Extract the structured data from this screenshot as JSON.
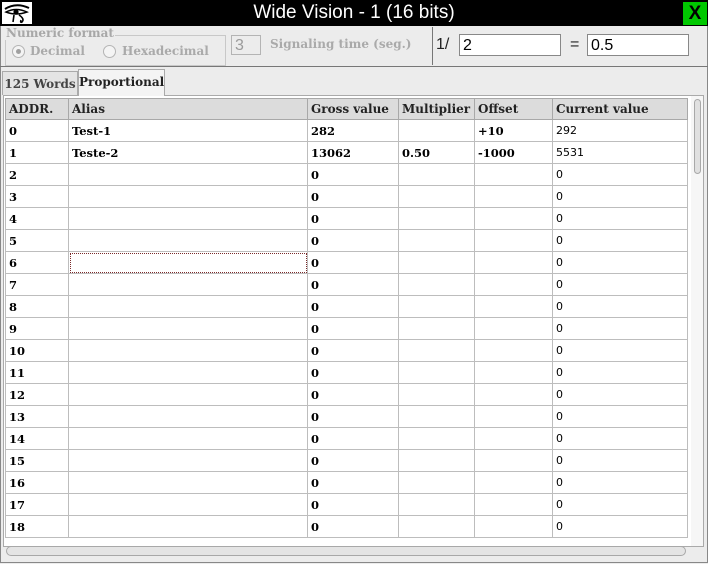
{
  "window": {
    "title": "Wide Vision - 1 (16 bits)",
    "close_label": "X"
  },
  "numeric_format": {
    "title": "Numeric format",
    "options": [
      {
        "label": "Decimal",
        "selected": true
      },
      {
        "label": "Hexadecimal",
        "selected": false
      }
    ]
  },
  "signaling": {
    "value": "3",
    "label": "Signaling time (seg.)"
  },
  "ratio": {
    "prefix": "1/",
    "denominator": "2",
    "equals": "=",
    "result": "0.5"
  },
  "tabs": [
    {
      "label": "125 Words",
      "active": false
    },
    {
      "label": "Proportional",
      "active": true
    }
  ],
  "table": {
    "headers": {
      "addr": "ADDR.",
      "alias": "Alias",
      "gross": "Gross value",
      "mult": "Multiplier",
      "offset": "Offset",
      "current": "Current value"
    },
    "rows": [
      {
        "addr": "0",
        "alias": "Test-1",
        "gross": "282",
        "mult": "",
        "offset": "+10",
        "current": "292"
      },
      {
        "addr": "1",
        "alias": "Teste-2",
        "gross": "13062",
        "mult": "0.50",
        "offset": "-1000",
        "current": "5531"
      },
      {
        "addr": "2",
        "alias": "",
        "gross": "0",
        "mult": "",
        "offset": "",
        "current": "0"
      },
      {
        "addr": "3",
        "alias": "",
        "gross": "0",
        "mult": "",
        "offset": "",
        "current": "0"
      },
      {
        "addr": "4",
        "alias": "",
        "gross": "0",
        "mult": "",
        "offset": "",
        "current": "0"
      },
      {
        "addr": "5",
        "alias": "",
        "gross": "0",
        "mult": "",
        "offset": "",
        "current": "0"
      },
      {
        "addr": "6",
        "alias": "",
        "gross": "0",
        "mult": "",
        "offset": "",
        "current": "0"
      },
      {
        "addr": "7",
        "alias": "",
        "gross": "0",
        "mult": "",
        "offset": "",
        "current": "0"
      },
      {
        "addr": "8",
        "alias": "",
        "gross": "0",
        "mult": "",
        "offset": "",
        "current": "0"
      },
      {
        "addr": "9",
        "alias": "",
        "gross": "0",
        "mult": "",
        "offset": "",
        "current": "0"
      },
      {
        "addr": "10",
        "alias": "",
        "gross": "0",
        "mult": "",
        "offset": "",
        "current": "0"
      },
      {
        "addr": "11",
        "alias": "",
        "gross": "0",
        "mult": "",
        "offset": "",
        "current": "0"
      },
      {
        "addr": "12",
        "alias": "",
        "gross": "0",
        "mult": "",
        "offset": "",
        "current": "0"
      },
      {
        "addr": "13",
        "alias": "",
        "gross": "0",
        "mult": "",
        "offset": "",
        "current": "0"
      },
      {
        "addr": "14",
        "alias": "",
        "gross": "0",
        "mult": "",
        "offset": "",
        "current": "0"
      },
      {
        "addr": "15",
        "alias": "",
        "gross": "0",
        "mult": "",
        "offset": "",
        "current": "0"
      },
      {
        "addr": "16",
        "alias": "",
        "gross": "0",
        "mult": "",
        "offset": "",
        "current": "0"
      },
      {
        "addr": "17",
        "alias": "",
        "gross": "0",
        "mult": "",
        "offset": "",
        "current": "0"
      },
      {
        "addr": "18",
        "alias": "",
        "gross": "0",
        "mult": "",
        "offset": "",
        "current": "0"
      }
    ]
  }
}
